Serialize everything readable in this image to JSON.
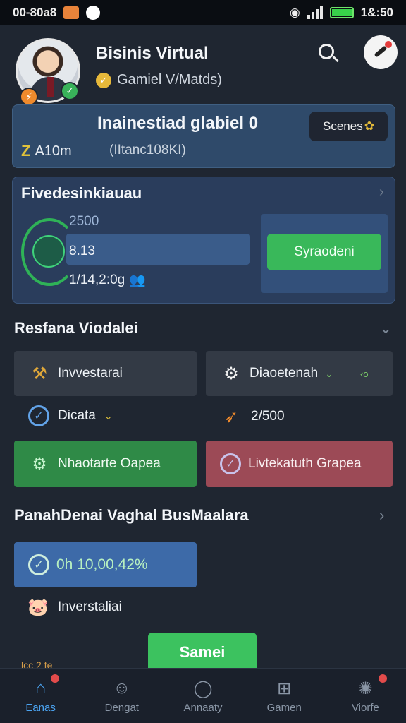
{
  "status": {
    "time_left": "00-80a8",
    "time_right": "1&:50"
  },
  "profile": {
    "name": "Bisinis Virtual",
    "subtitle": "Gamiel V/Matds)"
  },
  "balance_card": {
    "title": "Inainestiad glabiel 0",
    "amount": "A10m",
    "amount_sub": "(IItanc108KI)",
    "scenes_label": "Scenes"
  },
  "investment_card": {
    "title": "Fivedesinkiauau",
    "value_top": "2500",
    "value_mid": "8.13",
    "value_bottom": "1/14,2:0g",
    "sync_label": "Syraodeni"
  },
  "section_reports": {
    "title": "Resfana Viodalei",
    "tile_invest": "Invvestarai",
    "tile_dashboard": "Diaoetenah",
    "tile_dashboard_extra": "‹ο",
    "row_data": "Dicata",
    "row_score": "2/500",
    "tile_green": "Nhaotarte Oapea",
    "tile_red": "Livtekatuth Grapea"
  },
  "section_business": {
    "title": "PanahDenai Vaghal BusMaalara",
    "stat": "0h 10,00,42%",
    "row_invest": "Inverstaliai",
    "peek_text": "lcc 2 fe",
    "save_label": "Samei"
  },
  "nav": [
    {
      "label": "Eanas",
      "icon": "home-icon"
    },
    {
      "label": "Dengat",
      "icon": "profile-icon"
    },
    {
      "label": "Annaaty",
      "icon": "chat-icon"
    },
    {
      "label": "Gamen",
      "icon": "games-icon"
    },
    {
      "label": "Viorfe",
      "icon": "settings-icon"
    }
  ],
  "colors": {
    "background": "#1f2631",
    "accent_green": "#39b85a",
    "accent_blue": "#4ba3f0",
    "card_blue": "#2f4a6a",
    "tile_red": "#9c4a56"
  }
}
